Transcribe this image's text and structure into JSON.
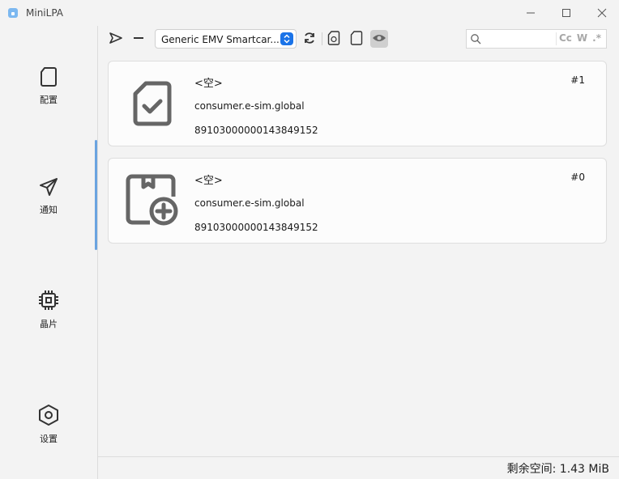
{
  "window": {
    "title": "MiniLPA"
  },
  "sidebar": {
    "items": [
      {
        "label": "配置",
        "icon": "sim-card-icon"
      },
      {
        "label": "通知",
        "icon": "paper-plane-icon"
      },
      {
        "label": "晶片",
        "icon": "chip-icon"
      },
      {
        "label": "设置",
        "icon": "hexagon-settings-icon"
      }
    ]
  },
  "toolbar": {
    "reader": "Generic EMV Smartcar..."
  },
  "search": {
    "placeholder": "",
    "options": [
      "Cc",
      "W",
      ".*"
    ]
  },
  "notifications": [
    {
      "name": "<空>",
      "provider": "consumer.e-sim.global",
      "iccid": "89103000000143849152",
      "index": "#1",
      "icon": "sim-check-icon"
    },
    {
      "name": "<空>",
      "provider": "consumer.e-sim.global",
      "iccid": "89103000000143849152",
      "index": "#0",
      "icon": "sim-add-icon"
    }
  ],
  "status": {
    "free_space": "剩余空间: 1.43 MiB"
  },
  "colors": {
    "accent": "#1a73e8",
    "indicator": "#6aa3e0"
  }
}
